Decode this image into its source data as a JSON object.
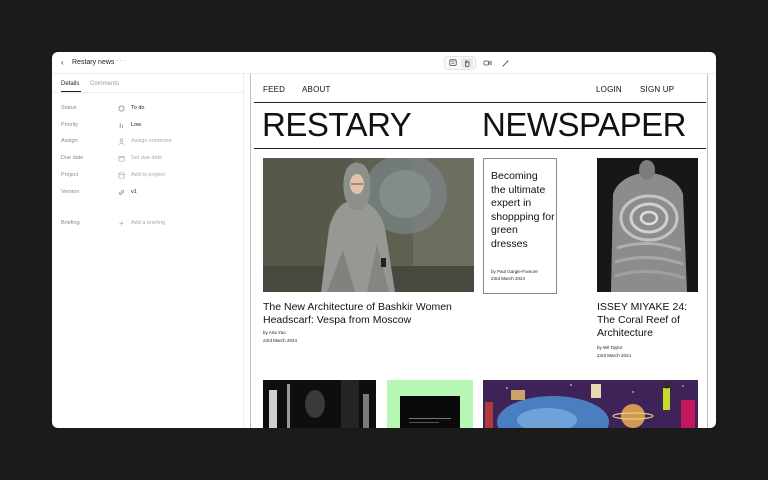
{
  "window": {
    "back_glyph": "‹",
    "title": "Restary news",
    "more_glyph": "···"
  },
  "toolbar": {
    "icons": [
      "comment-icon",
      "hand-icon",
      "video-icon",
      "magic-icon"
    ]
  },
  "sidebar": {
    "tabs": [
      "Details",
      "Comments"
    ],
    "active_tab": "Details",
    "properties": [
      {
        "label": "Status",
        "icon": "circle-icon",
        "value": "To do",
        "set": true
      },
      {
        "label": "Priority",
        "icon": "priority-icon",
        "value": "Low",
        "set": true
      },
      {
        "label": "Assign",
        "icon": "user-icon",
        "value": "Assign someone",
        "set": false
      },
      {
        "label": "Due date",
        "icon": "calendar-icon",
        "value": "Set due date",
        "set": false
      },
      {
        "label": "Project",
        "icon": "folder-icon",
        "value": "Add to project",
        "set": false
      },
      {
        "label": "Version",
        "icon": "link-icon",
        "value": "v1",
        "set": true
      },
      {
        "label": "Briefing",
        "icon": "plus-icon",
        "value": "Add a briefing",
        "set": false
      }
    ]
  },
  "site": {
    "nav": {
      "feed": "FEED",
      "about": "ABOUT",
      "login": "LOGIN",
      "signup": "SIGN UP"
    },
    "masthead": {
      "left": "RESTARY",
      "right": "NEWSPAPER"
    },
    "articles": [
      {
        "headline": "The New Architecture of Bashkir Women Headscarf: Vespa from Moscow",
        "author": "by Aria Yao",
        "date": "23rd March 2024"
      },
      {
        "headline": "Becoming the ultimate expert in shoppping for green dresses",
        "author": "by Paul Gargle-Fomore",
        "date": "23rd March 2024"
      },
      {
        "headline": "ISSEY MIYAKE 24: The Coral Reef of Architecture",
        "author": "by Wil Taylor",
        "date": "23rd March 2024"
      }
    ],
    "colors": {
      "accent_green": "#b6f7b4",
      "ink": "#111111"
    }
  }
}
